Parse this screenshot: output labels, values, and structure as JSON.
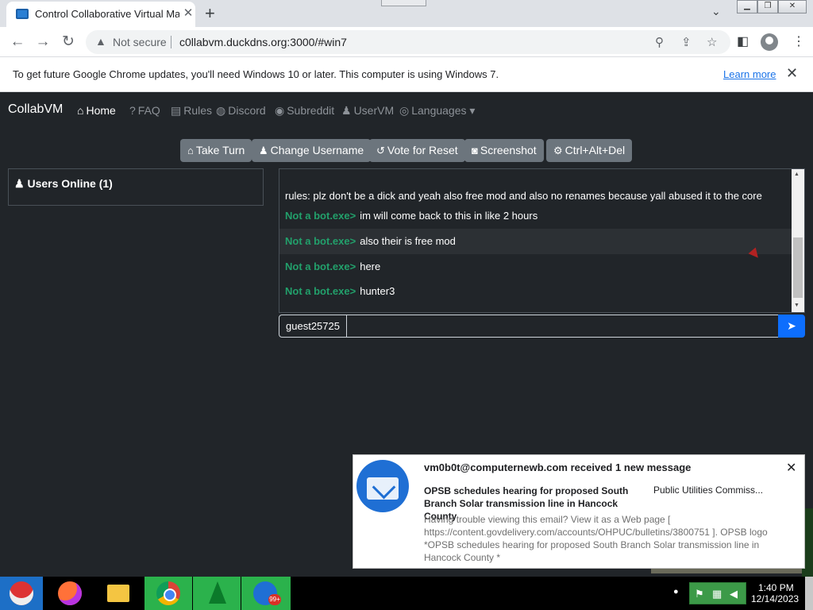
{
  "browser": {
    "tab_title": "Control Collaborative Virtual Machines",
    "new_tab": "+",
    "not_secure": "Not secure",
    "url": "c0llabvm.duckdns.org:3000/#win7",
    "infobar_text": "To get future Google Chrome updates, you'll need Windows 10 or later. This computer is using Windows 7.",
    "infobar_link": "Learn more"
  },
  "nav": {
    "brand": "CollabVM",
    "items": [
      "Home",
      "FAQ",
      "Rules",
      "Discord",
      "Subreddit",
      "UserVM",
      "Languages"
    ]
  },
  "vm_buttons": [
    "Take Turn",
    "Change Username",
    "Vote for Reset",
    "Screenshot",
    "Ctrl+Alt+Del"
  ],
  "users": {
    "title": "Users Online (1)"
  },
  "chat": {
    "messages": [
      {
        "user": "",
        "text": "rules: plz don't be a dick and yeah also free mod and also no renames because yall abused it to the core"
      },
      {
        "user": "Not a bot.exe>",
        "text": "im will come back to this in like 2 hours"
      },
      {
        "user": "Not a bot.exe>",
        "text": "also their is free mod"
      },
      {
        "user": "Not a bot.exe>",
        "text": "here"
      },
      {
        "user": "Not a bot.exe>",
        "text": "hunter3"
      }
    ],
    "username": "guest25725",
    "input_value": ""
  },
  "notification": {
    "header": "vm0b0t@computernewb.com received 1 new message",
    "subject": "OPSB schedules hearing for proposed South Branch Solar transmission line in Hancock County",
    "sender": "Public Utilities Commiss...",
    "body": "Having trouble viewing this email? View it as a Web page [ https://content.govdelivery.com/accounts/OHPUC/bulletins/3800751 ]. OPSB logo *OPSB schedules hearing for proposed South Branch Solar transmission line in Hancock County *"
  },
  "taskbar": {
    "badge": "99+",
    "time": "1:40 PM",
    "date": "12/14/2023"
  },
  "colors": {
    "page_bg": "#212529",
    "button_gray": "#6c757d",
    "chat_user_green": "#22a06b",
    "send_blue": "#0d6efd",
    "start_blue": "#1d6fc6"
  }
}
